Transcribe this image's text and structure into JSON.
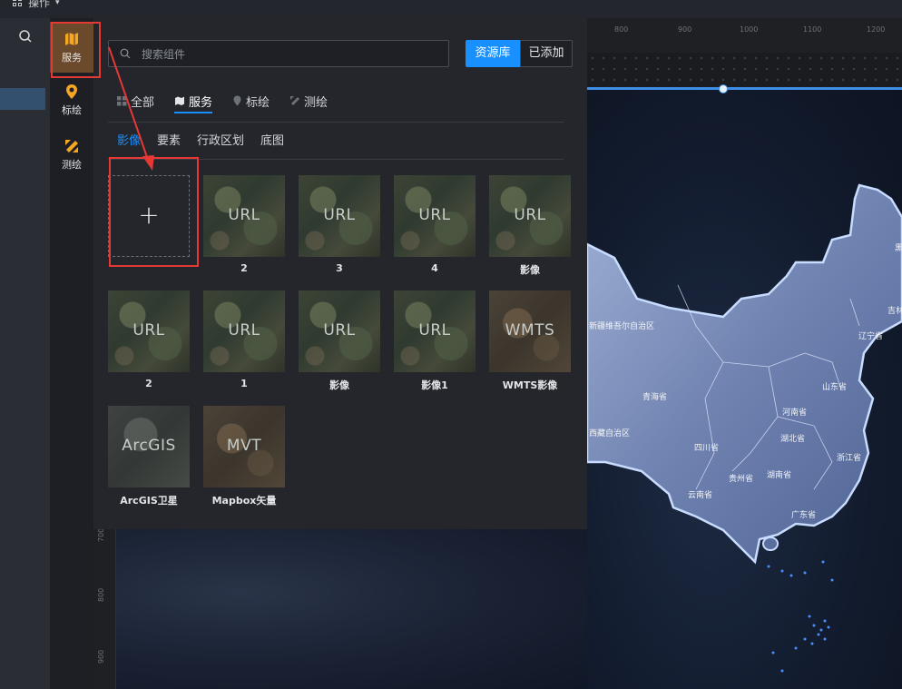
{
  "topbar": {
    "menu_label": "操作"
  },
  "sidebar": {
    "items": [
      {
        "label": "服务",
        "icon": "map-icon",
        "active": true
      },
      {
        "label": "标绘",
        "icon": "pin-icon",
        "active": false
      },
      {
        "label": "测绘",
        "icon": "ruler-pencil-icon",
        "active": false
      }
    ]
  },
  "panel": {
    "search_placeholder": "搜索组件",
    "source_toggle": {
      "library": "资源库",
      "added": "已添加",
      "selected": "资源库"
    },
    "tabs": [
      {
        "label": "全部",
        "icon": "grid-icon"
      },
      {
        "label": "服务",
        "icon": "map-icon",
        "active": true
      },
      {
        "label": "标绘",
        "icon": "pin-icon"
      },
      {
        "label": "测绘",
        "icon": "ruler-pencil-icon"
      }
    ],
    "subtabs": [
      {
        "label": "影像",
        "active": true
      },
      {
        "label": "要素"
      },
      {
        "label": "行政区划"
      },
      {
        "label": "底图"
      }
    ],
    "add_button": "+",
    "cards": [
      {
        "thumb_text": "URL",
        "caption": "2"
      },
      {
        "thumb_text": "URL",
        "caption": "3"
      },
      {
        "thumb_text": "URL",
        "caption": "4"
      },
      {
        "thumb_text": "URL",
        "caption": "影像"
      },
      {
        "thumb_text": "URL",
        "caption": "2"
      },
      {
        "thumb_text": "URL",
        "caption": "1"
      },
      {
        "thumb_text": "URL",
        "caption": "影像"
      },
      {
        "thumb_text": "URL",
        "caption": "影像1"
      },
      {
        "thumb_text": "WMTS",
        "caption": "WMTS影像"
      },
      {
        "thumb_text": "ArcGIS",
        "caption": "ArcGIS卫星"
      },
      {
        "thumb_text": "MVT",
        "caption": "Mapbox矢量"
      }
    ]
  },
  "ruler": {
    "top_ticks": [
      "800",
      "900",
      "1000",
      "1100",
      "1200"
    ],
    "left_ticks": [
      "700",
      "800",
      "900"
    ]
  },
  "map": {
    "province_labels": [
      "新疆维吾尔自治区",
      "青海省",
      "西藏自治区",
      "四川省",
      "云南省",
      "贵州省",
      "湖南省",
      "湖北省",
      "河南省",
      "山东省",
      "浙江省",
      "辽宁省",
      "吉林",
      "广东省",
      "黑"
    ]
  },
  "colors": {
    "accent": "#1890ff",
    "active_sidebar": "#6b4a2c",
    "highlight_box": "#e53935"
  }
}
